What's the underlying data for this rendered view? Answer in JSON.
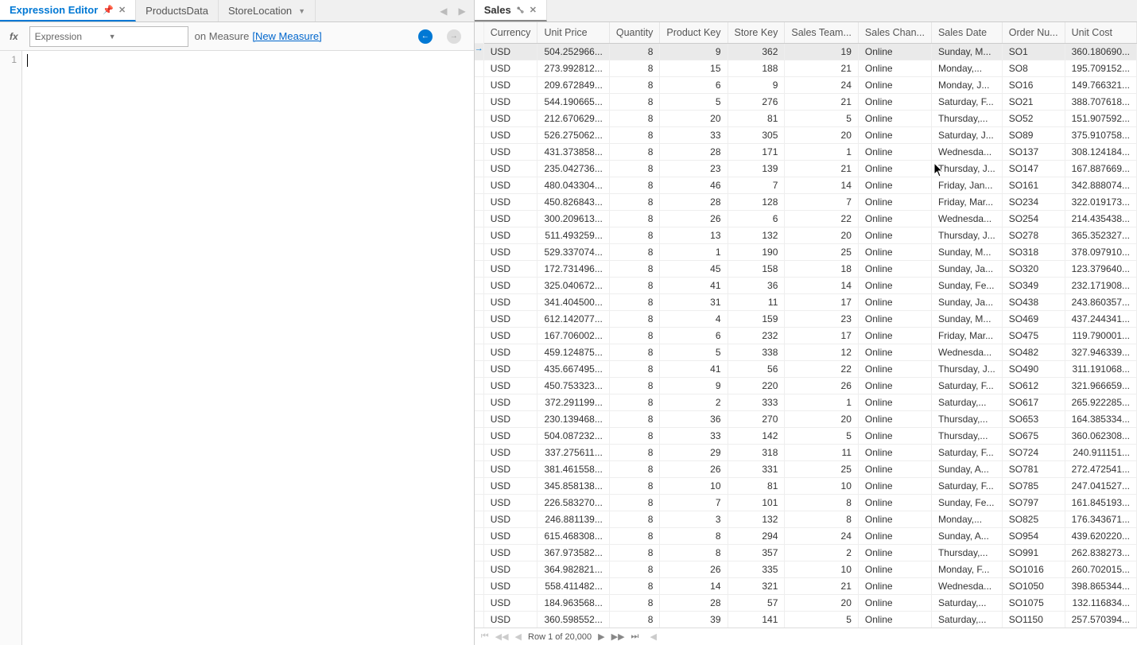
{
  "leftTabs": [
    {
      "label": "Expression Editor",
      "active": true,
      "pinned": true,
      "closable": true
    },
    {
      "label": "ProductsData",
      "active": false
    },
    {
      "label": "StoreLocation",
      "active": false,
      "hasDropdown": true
    }
  ],
  "fxLabel": "fx",
  "expressionPlaceholder": "Expression",
  "measurePrefix": "on Measure",
  "measureLink": "[New Measure]",
  "lineNumber": "1",
  "salesTab": "Sales",
  "columns": [
    "Currency",
    "Unit Price",
    "Quantity",
    "Product Key",
    "Store Key",
    "Sales Team...",
    "Sales Chan...",
    "Sales Date",
    "Order Nu...",
    "Unit Cost"
  ],
  "rows": [
    {
      "sel": true,
      "currency": "USD",
      "unit_price": "504.252966...",
      "quantity": "8",
      "product_key": "9",
      "store_key": "362",
      "sales_team": "19",
      "sales_chan": "Online",
      "sales_date": "Sunday, M...",
      "order_num": "SO1",
      "unit_cost": "360.180690..."
    },
    {
      "currency": "USD",
      "unit_price": "273.992812...",
      "quantity": "8",
      "product_key": "15",
      "store_key": "188",
      "sales_team": "21",
      "sales_chan": "Online",
      "sales_date": "Monday,...",
      "order_num": "SO8",
      "unit_cost": "195.709152..."
    },
    {
      "currency": "USD",
      "unit_price": "209.672849...",
      "quantity": "8",
      "product_key": "6",
      "store_key": "9",
      "sales_team": "24",
      "sales_chan": "Online",
      "sales_date": "Monday, J...",
      "order_num": "SO16",
      "unit_cost": "149.766321..."
    },
    {
      "currency": "USD",
      "unit_price": "544.190665...",
      "quantity": "8",
      "product_key": "5",
      "store_key": "276",
      "sales_team": "21",
      "sales_chan": "Online",
      "sales_date": "Saturday, F...",
      "order_num": "SO21",
      "unit_cost": "388.707618..."
    },
    {
      "currency": "USD",
      "unit_price": "212.670629...",
      "quantity": "8",
      "product_key": "20",
      "store_key": "81",
      "sales_team": "5",
      "sales_chan": "Online",
      "sales_date": "Thursday,...",
      "order_num": "SO52",
      "unit_cost": "151.907592..."
    },
    {
      "currency": "USD",
      "unit_price": "526.275062...",
      "quantity": "8",
      "product_key": "33",
      "store_key": "305",
      "sales_team": "20",
      "sales_chan": "Online",
      "sales_date": "Saturday, J...",
      "order_num": "SO89",
      "unit_cost": "375.910758..."
    },
    {
      "currency": "USD",
      "unit_price": "431.373858...",
      "quantity": "8",
      "product_key": "28",
      "store_key": "171",
      "sales_team": "1",
      "sales_chan": "Online",
      "sales_date": "Wednesda...",
      "order_num": "SO137",
      "unit_cost": "308.124184..."
    },
    {
      "currency": "USD",
      "unit_price": "235.042736...",
      "quantity": "8",
      "product_key": "23",
      "store_key": "139",
      "sales_team": "21",
      "sales_chan": "Online",
      "sales_date": "Thursday, J...",
      "order_num": "SO147",
      "unit_cost": "167.887669..."
    },
    {
      "currency": "USD",
      "unit_price": "480.043304...",
      "quantity": "8",
      "product_key": "46",
      "store_key": "7",
      "sales_team": "14",
      "sales_chan": "Online",
      "sales_date": "Friday, Jan...",
      "order_num": "SO161",
      "unit_cost": "342.888074..."
    },
    {
      "currency": "USD",
      "unit_price": "450.826843...",
      "quantity": "8",
      "product_key": "28",
      "store_key": "128",
      "sales_team": "7",
      "sales_chan": "Online",
      "sales_date": "Friday, Mar...",
      "order_num": "SO234",
      "unit_cost": "322.019173..."
    },
    {
      "currency": "USD",
      "unit_price": "300.209613...",
      "quantity": "8",
      "product_key": "26",
      "store_key": "6",
      "sales_team": "22",
      "sales_chan": "Online",
      "sales_date": "Wednesda...",
      "order_num": "SO254",
      "unit_cost": "214.435438..."
    },
    {
      "currency": "USD",
      "unit_price": "511.493259...",
      "quantity": "8",
      "product_key": "13",
      "store_key": "132",
      "sales_team": "20",
      "sales_chan": "Online",
      "sales_date": "Thursday, J...",
      "order_num": "SO278",
      "unit_cost": "365.352327..."
    },
    {
      "currency": "USD",
      "unit_price": "529.337074...",
      "quantity": "8",
      "product_key": "1",
      "store_key": "190",
      "sales_team": "25",
      "sales_chan": "Online",
      "sales_date": "Sunday, M...",
      "order_num": "SO318",
      "unit_cost": "378.097910..."
    },
    {
      "currency": "USD",
      "unit_price": "172.731496...",
      "quantity": "8",
      "product_key": "45",
      "store_key": "158",
      "sales_team": "18",
      "sales_chan": "Online",
      "sales_date": "Sunday, Ja...",
      "order_num": "SO320",
      "unit_cost": "123.379640..."
    },
    {
      "currency": "USD",
      "unit_price": "325.040672...",
      "quantity": "8",
      "product_key": "41",
      "store_key": "36",
      "sales_team": "14",
      "sales_chan": "Online",
      "sales_date": "Sunday, Fe...",
      "order_num": "SO349",
      "unit_cost": "232.171908..."
    },
    {
      "currency": "USD",
      "unit_price": "341.404500...",
      "quantity": "8",
      "product_key": "31",
      "store_key": "11",
      "sales_team": "17",
      "sales_chan": "Online",
      "sales_date": "Sunday, Ja...",
      "order_num": "SO438",
      "unit_cost": "243.860357..."
    },
    {
      "currency": "USD",
      "unit_price": "612.142077...",
      "quantity": "8",
      "product_key": "4",
      "store_key": "159",
      "sales_team": "23",
      "sales_chan": "Online",
      "sales_date": "Sunday, M...",
      "order_num": "SO469",
      "unit_cost": "437.244341..."
    },
    {
      "currency": "USD",
      "unit_price": "167.706002...",
      "quantity": "8",
      "product_key": "6",
      "store_key": "232",
      "sales_team": "17",
      "sales_chan": "Online",
      "sales_date": "Friday, Mar...",
      "order_num": "SO475",
      "unit_cost": "119.790001..."
    },
    {
      "currency": "USD",
      "unit_price": "459.124875...",
      "quantity": "8",
      "product_key": "5",
      "store_key": "338",
      "sales_team": "12",
      "sales_chan": "Online",
      "sales_date": "Wednesda...",
      "order_num": "SO482",
      "unit_cost": "327.946339..."
    },
    {
      "currency": "USD",
      "unit_price": "435.667495...",
      "quantity": "8",
      "product_key": "41",
      "store_key": "56",
      "sales_team": "22",
      "sales_chan": "Online",
      "sales_date": "Thursday, J...",
      "order_num": "SO490",
      "unit_cost": "311.191068..."
    },
    {
      "currency": "USD",
      "unit_price": "450.753323...",
      "quantity": "8",
      "product_key": "9",
      "store_key": "220",
      "sales_team": "26",
      "sales_chan": "Online",
      "sales_date": "Saturday, F...",
      "order_num": "SO612",
      "unit_cost": "321.966659..."
    },
    {
      "currency": "USD",
      "unit_price": "372.291199...",
      "quantity": "8",
      "product_key": "2",
      "store_key": "333",
      "sales_team": "1",
      "sales_chan": "Online",
      "sales_date": "Saturday,...",
      "order_num": "SO617",
      "unit_cost": "265.922285..."
    },
    {
      "currency": "USD",
      "unit_price": "230.139468...",
      "quantity": "8",
      "product_key": "36",
      "store_key": "270",
      "sales_team": "20",
      "sales_chan": "Online",
      "sales_date": "Thursday,...",
      "order_num": "SO653",
      "unit_cost": "164.385334..."
    },
    {
      "currency": "USD",
      "unit_price": "504.087232...",
      "quantity": "8",
      "product_key": "33",
      "store_key": "142",
      "sales_team": "5",
      "sales_chan": "Online",
      "sales_date": "Thursday,...",
      "order_num": "SO675",
      "unit_cost": "360.062308..."
    },
    {
      "currency": "USD",
      "unit_price": "337.275611...",
      "quantity": "8",
      "product_key": "29",
      "store_key": "318",
      "sales_team": "11",
      "sales_chan": "Online",
      "sales_date": "Saturday, F...",
      "order_num": "SO724",
      "unit_cost": "240.911151..."
    },
    {
      "currency": "USD",
      "unit_price": "381.461558...",
      "quantity": "8",
      "product_key": "26",
      "store_key": "331",
      "sales_team": "25",
      "sales_chan": "Online",
      "sales_date": "Sunday, A...",
      "order_num": "SO781",
      "unit_cost": "272.472541..."
    },
    {
      "currency": "USD",
      "unit_price": "345.858138...",
      "quantity": "8",
      "product_key": "10",
      "store_key": "81",
      "sales_team": "10",
      "sales_chan": "Online",
      "sales_date": "Saturday, F...",
      "order_num": "SO785",
      "unit_cost": "247.041527..."
    },
    {
      "currency": "USD",
      "unit_price": "226.583270...",
      "quantity": "8",
      "product_key": "7",
      "store_key": "101",
      "sales_team": "8",
      "sales_chan": "Online",
      "sales_date": "Sunday, Fe...",
      "order_num": "SO797",
      "unit_cost": "161.845193..."
    },
    {
      "currency": "USD",
      "unit_price": "246.881139...",
      "quantity": "8",
      "product_key": "3",
      "store_key": "132",
      "sales_team": "8",
      "sales_chan": "Online",
      "sales_date": "Monday,...",
      "order_num": "SO825",
      "unit_cost": "176.343671..."
    },
    {
      "currency": "USD",
      "unit_price": "615.468308...",
      "quantity": "8",
      "product_key": "8",
      "store_key": "294",
      "sales_team": "24",
      "sales_chan": "Online",
      "sales_date": "Sunday, A...",
      "order_num": "SO954",
      "unit_cost": "439.620220..."
    },
    {
      "currency": "USD",
      "unit_price": "367.973582...",
      "quantity": "8",
      "product_key": "8",
      "store_key": "357",
      "sales_team": "2",
      "sales_chan": "Online",
      "sales_date": "Thursday,...",
      "order_num": "SO991",
      "unit_cost": "262.838273..."
    },
    {
      "currency": "USD",
      "unit_price": "364.982821...",
      "quantity": "8",
      "product_key": "26",
      "store_key": "335",
      "sales_team": "10",
      "sales_chan": "Online",
      "sales_date": "Monday, F...",
      "order_num": "SO1016",
      "unit_cost": "260.702015..."
    },
    {
      "currency": "USD",
      "unit_price": "558.411482...",
      "quantity": "8",
      "product_key": "14",
      "store_key": "321",
      "sales_team": "21",
      "sales_chan": "Online",
      "sales_date": "Wednesda...",
      "order_num": "SO1050",
      "unit_cost": "398.865344..."
    },
    {
      "currency": "USD",
      "unit_price": "184.963568...",
      "quantity": "8",
      "product_key": "28",
      "store_key": "57",
      "sales_team": "20",
      "sales_chan": "Online",
      "sales_date": "Saturday,...",
      "order_num": "SO1075",
      "unit_cost": "132.116834..."
    },
    {
      "currency": "USD",
      "unit_price": "360.598552...",
      "quantity": "8",
      "product_key": "39",
      "store_key": "141",
      "sales_team": "5",
      "sales_chan": "Online",
      "sales_date": "Saturday,...",
      "order_num": "SO1150",
      "unit_cost": "257.570394..."
    }
  ],
  "pager": {
    "text": "Row 1 of 20,000"
  }
}
